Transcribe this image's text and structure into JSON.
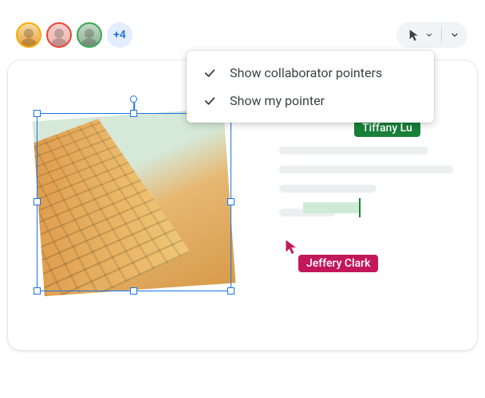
{
  "collaborators": {
    "more_count": "+4"
  },
  "dropdown": {
    "item1": "Show collaborator pointers",
    "item2": "Show my pointer"
  },
  "user_tags": {
    "tiffany": "Tiffany Lu",
    "jeffery": "Jeffery Clark"
  },
  "colors": {
    "tiffany": "#188038",
    "jeffery": "#c2185b",
    "selection": "#1a73e8"
  },
  "icons": {
    "pointer": "pointer-icon",
    "chevron_down": "chevron-down-icon",
    "check": "check-icon"
  }
}
